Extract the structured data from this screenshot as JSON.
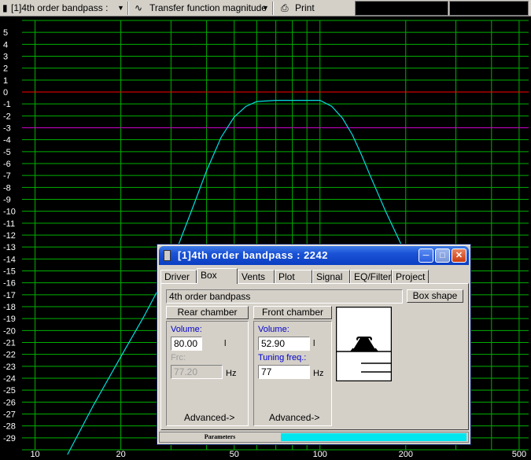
{
  "toolbar": {
    "project_select": "[1]4th order bandpass :",
    "graph_select": "Transfer function magnitude",
    "print_label": "Print"
  },
  "chart_data": {
    "type": "line",
    "xscale": "log",
    "xlim": [
      9,
      540
    ],
    "ylim": [
      -30,
      6
    ],
    "x_ticks": [
      10,
      20,
      50,
      100,
      200,
      500
    ],
    "y_ticks": [
      5,
      4,
      3,
      2,
      1,
      0,
      -1,
      -2,
      -3,
      -4,
      -5,
      -6,
      -7,
      -8,
      -9,
      -10,
      -11,
      -12,
      -13,
      -14,
      -15,
      -16,
      -17,
      -18,
      -19,
      -20,
      -21,
      -22,
      -23,
      -24,
      -25,
      -26,
      -27,
      -28,
      -29
    ],
    "grid": true,
    "reference_lines": [
      {
        "y": 0,
        "color": "#ff0000"
      },
      {
        "y": -3,
        "color": "#cc00cc"
      }
    ],
    "series": [
      {
        "color": "#00e0e0",
        "x": [
          13,
          16,
          20,
          24,
          28,
          32,
          36,
          40,
          45,
          50,
          55,
          60,
          70,
          80,
          90,
          100,
          110,
          120,
          130,
          140,
          150,
          170,
          200,
          230,
          250
        ],
        "y": [
          -30.4,
          -26.3,
          -22.2,
          -18.9,
          -15.9,
          -12.7,
          -9.5,
          -6.6,
          -3.8,
          -2.1,
          -1.2,
          -0.8,
          -0.7,
          -0.7,
          -0.7,
          -0.7,
          -1.2,
          -2.2,
          -3.6,
          -5.3,
          -7.0,
          -10.0,
          -13.6,
          -16.6,
          -18.4
        ]
      }
    ]
  },
  "window": {
    "title": "[1]4th order bandpass : 2242",
    "tabs": [
      "Driver",
      "Box",
      "Vents",
      "Plot",
      "Signal",
      "EQ/Filter",
      "Project"
    ],
    "active_tab": "Box",
    "box_type": "4th order bandpass",
    "box_shape_button": "Box shape",
    "rear": {
      "button": "Rear chamber",
      "volume_label": "Volume:",
      "volume_value": "80.00",
      "volume_unit": "l",
      "frc_label": "Frc:",
      "frc_value": "77.20",
      "frc_unit": "Hz",
      "advanced": "Advanced->"
    },
    "front": {
      "button": "Front chamber",
      "volume_label": "Volume:",
      "volume_value": "52.90",
      "volume_unit": "l",
      "tuning_label": "Tuning freq.:",
      "tuning_value": "77",
      "tuning_unit": "Hz",
      "advanced": "Advanced->"
    },
    "status_label": "Parameters",
    "status_progress": 1.0,
    "status_color": "#00e5ee"
  }
}
